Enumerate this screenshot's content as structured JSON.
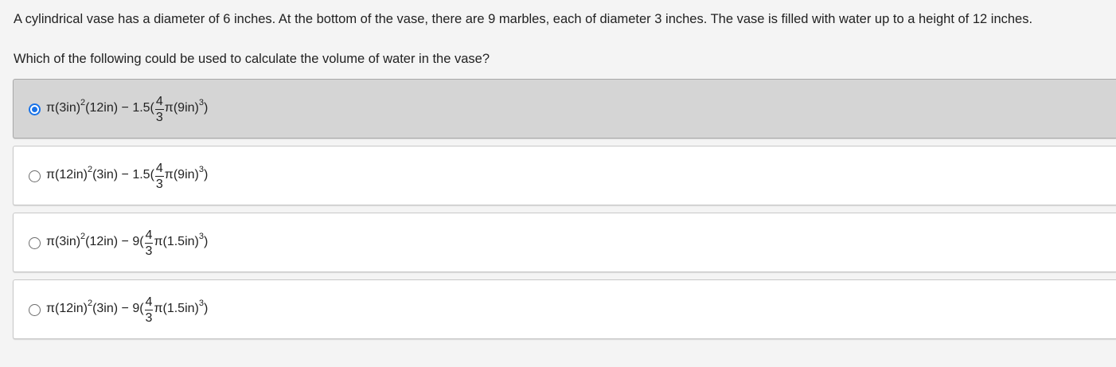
{
  "question": {
    "text": "A cylindrical vase has a diameter of 6 inches. At the bottom of the vase, there are 9 marbles, each of diameter 3 inches. The vase is filled with water up to a height of 12 inches.",
    "prompt": "Which of the following could be used to calculate the volume of water in the vase?"
  },
  "choices": [
    {
      "selected": true,
      "pre": "π(3in)",
      "sq": "2",
      "mid": "(12in) − 1.5(",
      "num": "4",
      "den": "3",
      "post": "π(9in)",
      "cube": "3",
      "end": ")"
    },
    {
      "selected": false,
      "pre": "π(12in)",
      "sq": "2",
      "mid": "(3in) − 1.5(",
      "num": "4",
      "den": "3",
      "post": "π(9in)",
      "cube": "3",
      "end": ")"
    },
    {
      "selected": false,
      "pre": "π(3in)",
      "sq": "2",
      "mid": "(12in) − 9(",
      "num": "4",
      "den": "3",
      "post": "π(1.5in)",
      "cube": "3",
      "end": ")"
    },
    {
      "selected": false,
      "pre": "π(12in)",
      "sq": "2",
      "mid": "(3in) − 9(",
      "num": "4",
      "den": "3",
      "post": "π(1.5in)",
      "cube": "3",
      "end": ")"
    }
  ],
  "colors": {
    "selected_bg": "#d5d5d5",
    "radio_checked": "#1a73e8",
    "page_bg": "#f4f4f4"
  }
}
